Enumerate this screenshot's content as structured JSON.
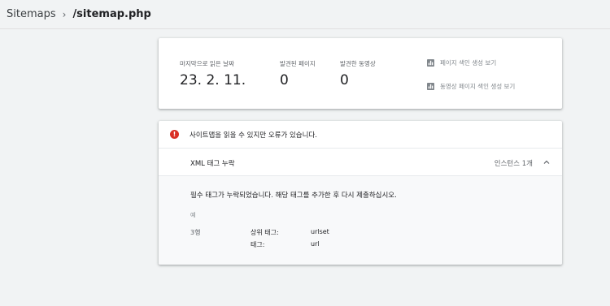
{
  "breadcrumb": {
    "parent": "Sitemaps",
    "separator": "›",
    "current": "/sitemap.php"
  },
  "summary": {
    "stats": [
      {
        "label": "마지막으로 읽은 날짜",
        "value": "23. 2. 11."
      },
      {
        "label": "발견된 페이지",
        "value": "0"
      },
      {
        "label": "발견한 동영상",
        "value": "0"
      }
    ],
    "links": [
      {
        "label": "페이지 색인 생성 보기",
        "icon": "bar-chart-icon"
      },
      {
        "label": "동영상 페이지 색인 생성 보기",
        "icon": "bar-chart-icon"
      }
    ]
  },
  "issues": {
    "error_icon": "error-icon",
    "title": "사이트맵을 읽을 수 있지만 오류가 있습니다.",
    "row": {
      "title": "XML 태그 누락",
      "count": "인스턴스 1개",
      "chevron": "chevron-up-icon"
    },
    "detail": {
      "message": "필수 태그가 누락되었습니다. 해당 태그를 추가한 후 다시 제출하십시오.",
      "example_label": "예",
      "line": "3행",
      "pairs": [
        {
          "key": "상위 태그:",
          "value": "urlset"
        },
        {
          "key": "태그:",
          "value": "url"
        }
      ]
    }
  },
  "colors": {
    "background": "#f1f3f4",
    "error": "#d93025",
    "muted": "#80868b"
  }
}
